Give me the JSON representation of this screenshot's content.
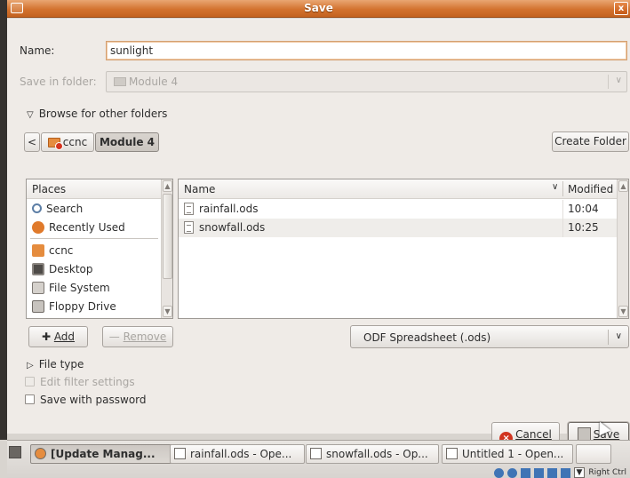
{
  "window": {
    "title": "Save",
    "close_glyph": "x"
  },
  "form": {
    "name_label": "Name:",
    "name_value": "sunlight",
    "folder_label": "Save in folder:",
    "folder_value": "Module 4",
    "browse_label": "Browse for other folders"
  },
  "breadcrumb": {
    "back_glyph": "<",
    "items": [
      "ccnc",
      "Module 4"
    ],
    "create_folder": "Create Folder"
  },
  "places": {
    "header": "Places",
    "items": [
      {
        "label": "Search",
        "icon": "search-icon"
      },
      {
        "label": "Recently Used",
        "icon": "recent-icon"
      },
      {
        "label": "ccnc",
        "icon": "home-folder-icon"
      },
      {
        "label": "Desktop",
        "icon": "desktop-icon"
      },
      {
        "label": "File System",
        "icon": "drive-icon"
      },
      {
        "label": "Floppy Drive",
        "icon": "floppy-icon"
      }
    ]
  },
  "files": {
    "col_name": "Name",
    "col_modified": "Modified",
    "sort_glyph": "∨",
    "rows": [
      {
        "name": "rainfall.ods",
        "modified": "10:04"
      },
      {
        "name": "snowfall.ods",
        "modified": "10:25"
      }
    ]
  },
  "actions": {
    "add": "Add",
    "remove": "Remove",
    "filter": "ODF Spreadsheet (.ods)",
    "file_type": "File type",
    "edit_filter": "Edit filter settings",
    "save_with_password": "Save with password",
    "cancel": "Cancel",
    "save": "Save"
  },
  "taskbar": {
    "tasks": [
      {
        "label": "[Update Manag...",
        "active": true
      },
      {
        "label": "rainfall.ods - Ope...",
        "active": false
      },
      {
        "label": "snowfall.ods - Op...",
        "active": false
      },
      {
        "label": "Untitled 1 - Open...",
        "active": false
      }
    ],
    "host_key": "Right Ctrl"
  },
  "colors": {
    "accent": "#d3732f",
    "focus_border": "#d4a071"
  }
}
